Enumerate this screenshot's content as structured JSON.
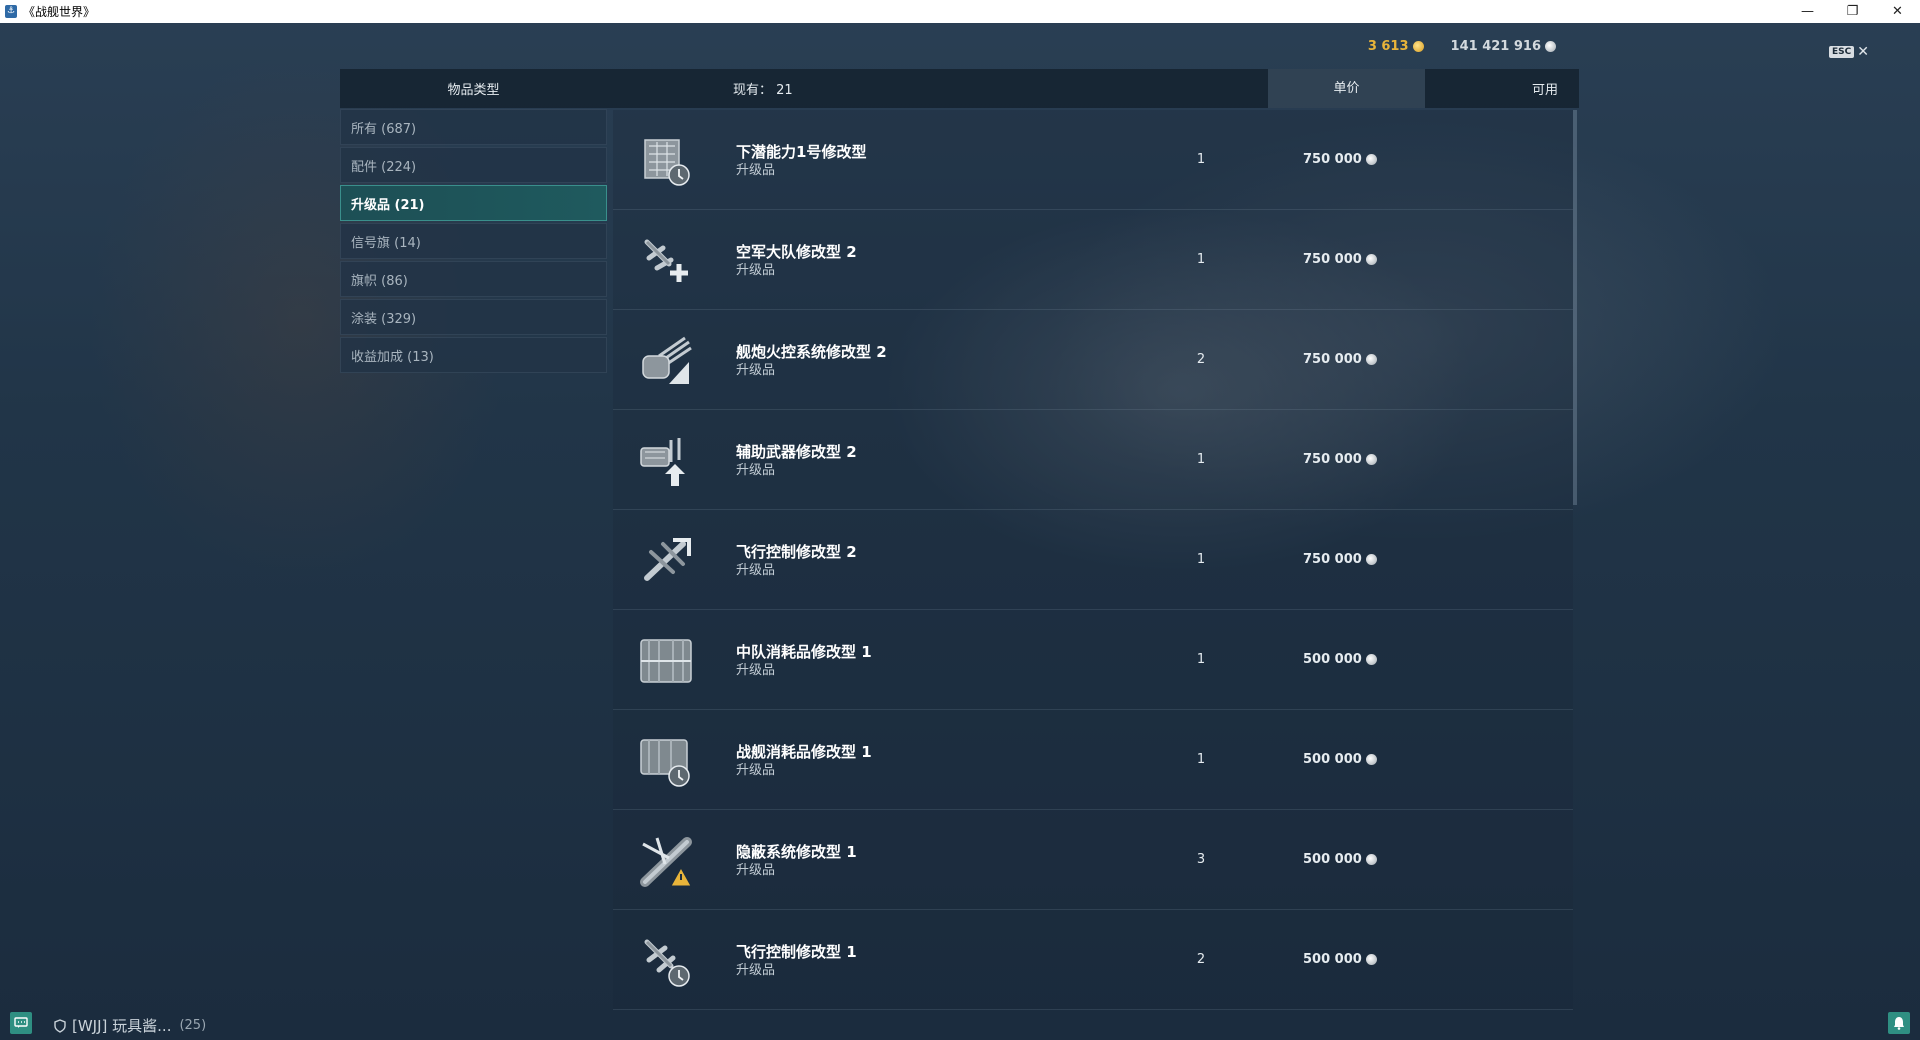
{
  "window": {
    "title": "《战舰世界》"
  },
  "currency": {
    "gold": "3 613",
    "silver": "141 421 916"
  },
  "esc": {
    "key": "ESC"
  },
  "header": {
    "type_col": "物品类型",
    "owned_label": "现有： 21",
    "avail_col": "可用",
    "price_col": "单价"
  },
  "categories": [
    {
      "label": "所有 (687)",
      "active": false
    },
    {
      "label": "配件 (224)",
      "active": false
    },
    {
      "label": "升级品 (21)",
      "active": true
    },
    {
      "label": "信号旗 (14)",
      "active": false
    },
    {
      "label": "旗帜 (86)",
      "active": false
    },
    {
      "label": "涂装 (329)",
      "active": false
    },
    {
      "label": "收益加成 (13)",
      "active": false
    }
  ],
  "items": [
    {
      "name": "下潜能力1号修改型",
      "type": "升级品",
      "available": "1",
      "price": "750 000",
      "icon": "submarine-module-icon"
    },
    {
      "name": "空军大队修改型 2",
      "type": "升级品",
      "available": "1",
      "price": "750 000",
      "icon": "aircraft-plus-icon"
    },
    {
      "name": "舰炮火控系统修改型 2",
      "type": "升级品",
      "available": "2",
      "price": "750 000",
      "icon": "gun-turret-icon"
    },
    {
      "name": "辅助武器修改型 2",
      "type": "升级品",
      "available": "1",
      "price": "750 000",
      "icon": "secondary-guns-icon"
    },
    {
      "name": "飞行控制修改型 2",
      "type": "升级品",
      "available": "1",
      "price": "750 000",
      "icon": "aircraft-arrow-icon"
    },
    {
      "name": "中队消耗品修改型 1",
      "type": "升级品",
      "available": "1",
      "price": "500 000",
      "icon": "consumable-box-icon"
    },
    {
      "name": "战舰消耗品修改型 1",
      "type": "升级品",
      "available": "1",
      "price": "500 000",
      "icon": "consumable-clock-icon"
    },
    {
      "name": "隐蔽系统修改型 1",
      "type": "升级品",
      "available": "3",
      "price": "500 000",
      "icon": "concealment-icon"
    },
    {
      "name": "飞行控制修改型 1",
      "type": "升级品",
      "available": "2",
      "price": "500 000",
      "icon": "aircraft-clock-icon"
    }
  ],
  "bottom": {
    "clan": "[WJJ]  玩具酱...",
    "count": "(25)"
  }
}
